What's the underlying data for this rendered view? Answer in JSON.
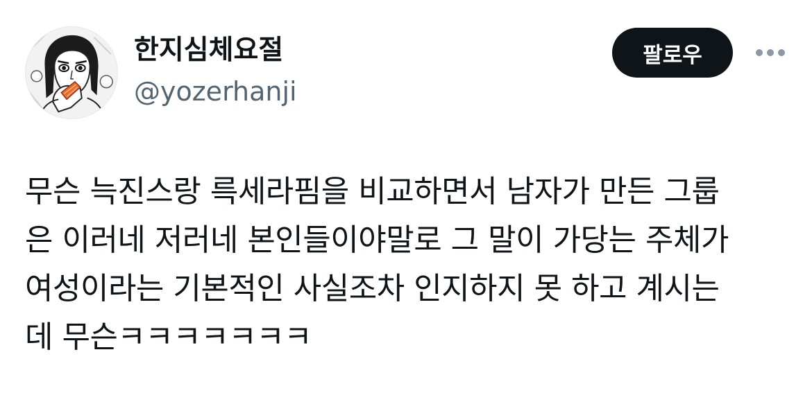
{
  "tweet": {
    "author": {
      "display_name": "한지심체요절",
      "handle": "@yozerhanji",
      "avatar_icon": "illustrated-portrait-avatar"
    },
    "follow_label": "팔로우",
    "more_icon": "more-horizontal-icon",
    "text_lines": [
      "무슨 늑진스랑 륵세라핌을 비교하면서 남자가 만든 그룹",
      "은 이러네 저러네 본인들이야말로 그 말이 가당는 주체가",
      "여성이라는 기본적인 사실조차 인지하지 못 하고 계시는",
      "데 무슨ㅋㅋㅋㅋㅋㅋㅋ"
    ]
  },
  "colors": {
    "text_primary": "#0f1419",
    "text_secondary": "#536471",
    "button_bg": "#0f1419",
    "button_text": "#ffffff",
    "background": "#ffffff",
    "more_icon": "#8b98a5"
  }
}
